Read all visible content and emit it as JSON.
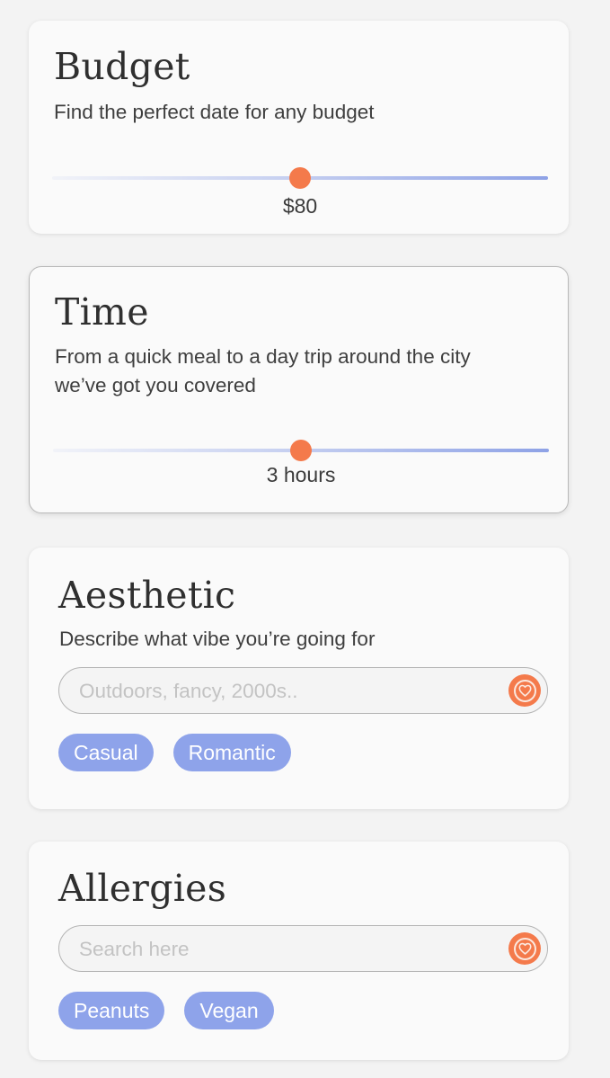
{
  "budget": {
    "title": "Budget",
    "subtitle": "Find the perfect date for any budget",
    "value_label": "$80",
    "slider_fraction": 0.5
  },
  "time": {
    "title": "Time",
    "subtitle_line1": "From a quick meal to a day trip around the city",
    "subtitle_line2": "we’ve got you covered",
    "value_label": "3 hours",
    "slider_fraction": 0.5
  },
  "aesthetic": {
    "title": "Aesthetic",
    "subtitle": "Describe what vibe you’re going for",
    "search_placeholder": "Outdoors, fancy, 2000s..",
    "search_value": "",
    "tags": [
      "Casual",
      "Romantic"
    ]
  },
  "allergies": {
    "title": "Allergies",
    "search_placeholder": "Search here",
    "search_value": "",
    "tags": [
      "Peanuts",
      "Vegan"
    ]
  },
  "colors": {
    "accent": "#f47a4b",
    "chip": "#8ea3ea",
    "track": "#8ea2e6"
  },
  "icons": {
    "search_button": "heart-icon"
  }
}
